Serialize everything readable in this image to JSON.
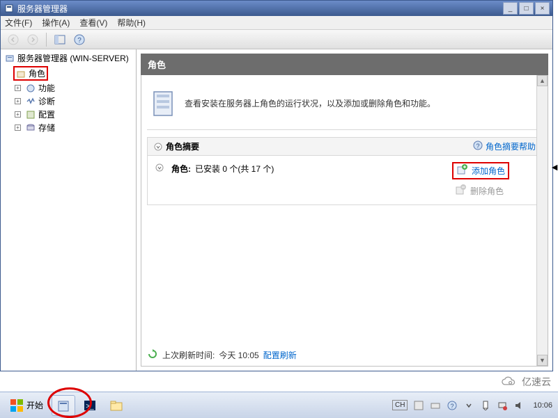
{
  "window": {
    "title": "服务器管理器",
    "minimize": "_",
    "maximize": "□",
    "close": "×"
  },
  "menu": {
    "file": "文件(F)",
    "action": "操作(A)",
    "view": "查看(V)",
    "help": "帮助(H)"
  },
  "tree": {
    "root": "服务器管理器 (WIN-SERVER)",
    "roles": "角色",
    "features": "功能",
    "diagnostics": "诊断",
    "configuration": "配置",
    "storage": "存储",
    "expand": "+",
    "collapse": "−"
  },
  "content": {
    "header": "角色",
    "description": "查看安装在服务器上角色的运行状况，以及添加或删除角色和功能。",
    "summary_title": "角色摘要",
    "summary_help": "角色摘要帮助",
    "roles_label": "角色:",
    "roles_count": "已安装 0 个(共 17 个)",
    "add_role": "添加角色",
    "remove_role": "删除角色",
    "refresh_prefix": "上次刷新时间:",
    "refresh_time": "今天 10:05",
    "refresh_config": "配置刷新"
  },
  "taskbar": {
    "start": "开始",
    "ime": "CH",
    "clock": "10:06"
  },
  "watermark": {
    "text": "亿速云"
  }
}
